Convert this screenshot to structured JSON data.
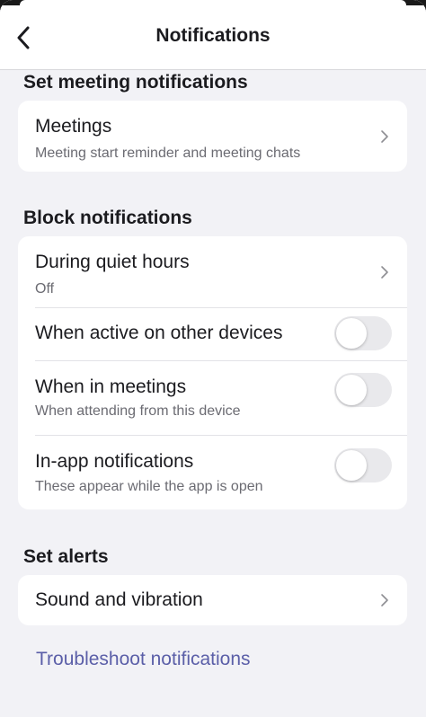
{
  "header": {
    "title": "Notifications",
    "back_icon": "chevron-left-icon"
  },
  "sections": {
    "meeting": {
      "title": "Set meeting notifications",
      "meetings": {
        "label": "Meetings",
        "sub": "Meeting start reminder and meeting chats"
      }
    },
    "block": {
      "title": "Block notifications",
      "quiet_hours": {
        "label": "During quiet hours",
        "sub": "Off"
      },
      "active_other": {
        "label": "When active on other devices",
        "on": false
      },
      "in_meetings": {
        "label": "When in meetings",
        "sub": "When attending from this device",
        "on": false
      },
      "in_app": {
        "label": "In-app notifications",
        "sub": "These appear while the app is open",
        "on": false
      }
    },
    "alerts": {
      "title": "Set alerts",
      "sound": {
        "label": "Sound and vibration"
      }
    }
  },
  "troubleshoot": {
    "label": "Troubleshoot notifications"
  },
  "colors": {
    "link": "#5b5fa8",
    "toggle_off": "#e9e9ec",
    "background": "#f2f2f6"
  }
}
